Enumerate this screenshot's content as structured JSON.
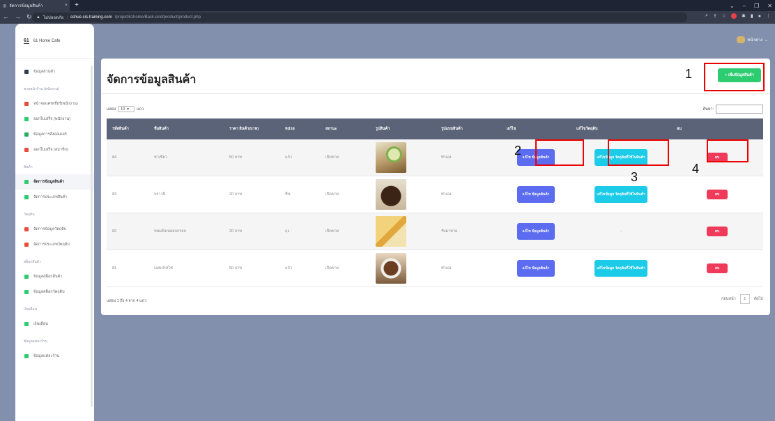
{
  "browser": {
    "tab_title": "จัดการข้อมูลสินค้า",
    "tab_close": "×",
    "new_tab": "+",
    "not_secure": "ไม่ปลอดภัย",
    "domain": "sshue.cis-training.com",
    "path": "/project61home/Back-end/product/product.php"
  },
  "user": {
    "name": "หน้าต่าง"
  },
  "sidebar": {
    "brand_logo": "61",
    "brand_name": "61 Home Cafe",
    "items": [
      {
        "label": "ข้อมูลส่วนตัว",
        "color": "#2c3e50"
      },
      {
        "section": "ขายหน้าร้าน (พนักงาน)"
      },
      {
        "label": "หน้าจอแคชเชียร์(พนักงาน)",
        "color": "#e74c3c"
      },
      {
        "label": "ออกใบเสร็จ (พนักงาน)",
        "color": "#2ecc71"
      },
      {
        "label": "ข้อมูลการสั่งออเดอร์",
        "color": "#27ae60"
      },
      {
        "label": "ออกใบเสร็จ (สมาชิก)",
        "color": "#e74c3c"
      },
      {
        "section": "สินค้า"
      },
      {
        "label": "จัดการข้อมูลสินค้า",
        "color": "#2ecc71",
        "active": true
      },
      {
        "label": "จัดการประเภทสินค้า",
        "color": "#2ecc71"
      },
      {
        "section": "วัตถุดิบ"
      },
      {
        "label": "จัดการข้อมูลวัตถุดิบ",
        "color": "#e74c3c"
      },
      {
        "label": "จัดการประเภทวัตถุดิบ",
        "color": "#e74c3c"
      },
      {
        "section": "สต็อกสินค้า"
      },
      {
        "label": "ข้อมูลสต็อกสินค้า",
        "color": "#2ecc71"
      },
      {
        "label": "ข้อมูลสต็อกวัตถุดิบ",
        "color": "#2ecc71"
      },
      {
        "section": "เงินเดือน"
      },
      {
        "label": "เงินเดือน",
        "color": "#2ecc71"
      },
      {
        "section": "ข้อมูลแต่ละร้าน"
      },
      {
        "label": "ข้อมูลแต่ละร้าน",
        "color": "#2ecc71"
      }
    ]
  },
  "page": {
    "title": "จัดการข้อมูลสินค้า",
    "add_button": "+ เพิ่มข้อมูลสินค้า",
    "show_label": "แสดง",
    "show_value": "10",
    "rows_label": "แถว",
    "search_label": "ค้นหา:",
    "info": "แสดง 1 ถึง 4 จาก 4 แถว",
    "prev": "ก่อนหน้า",
    "page_no": "1",
    "next": "ถัดไป"
  },
  "annotations": [
    "1",
    "2",
    "3",
    "4"
  ],
  "table": {
    "headers": [
      "รหัสสินค้า",
      "ชื่อสินค้า",
      "ราคา สินค้า(บาท)",
      "หน่วย",
      "สถานะ",
      "รูปสินค้า",
      "รูปแบบสินค้า",
      "แก้ไข",
      "แก้ไขวัตถุดิบ",
      "ลบ"
    ],
    "edit_label": "แก้ไข ข้อมูลสินค้า",
    "raw_label": "แก้ไขข้อมูล วัตถุดิบที่ใช้ในสินค้า",
    "del_label": "ลบ",
    "rows": [
      {
        "id": "84",
        "name": "ชาเขียว",
        "price": "50 บาท",
        "unit": "แก้ว",
        "status": "เปิดขาย",
        "img": "green-tea",
        "type": "ทำเอง",
        "raw": true
      },
      {
        "id": "83",
        "name": "บราวนี่",
        "price": "20 บาท",
        "unit": "ชิ้น",
        "status": "เปิดขาย",
        "img": "brownie",
        "type": "ทำเอง",
        "raw": true
      },
      {
        "id": "82",
        "name": "ขนมปังเนยอบกรอบ",
        "price": "20 บาท",
        "unit": "ถุง",
        "status": "เปิดขาย",
        "img": "toast",
        "type": "รับมาขาย",
        "raw": false,
        "raw_text": "-"
      },
      {
        "id": "81",
        "name": "เอสเปรสโซ่",
        "price": "50 บาท",
        "unit": "แก้ว",
        "status": "เปิดขาย",
        "img": "espresso",
        "type": "ทำเอง",
        "raw": true
      }
    ]
  }
}
